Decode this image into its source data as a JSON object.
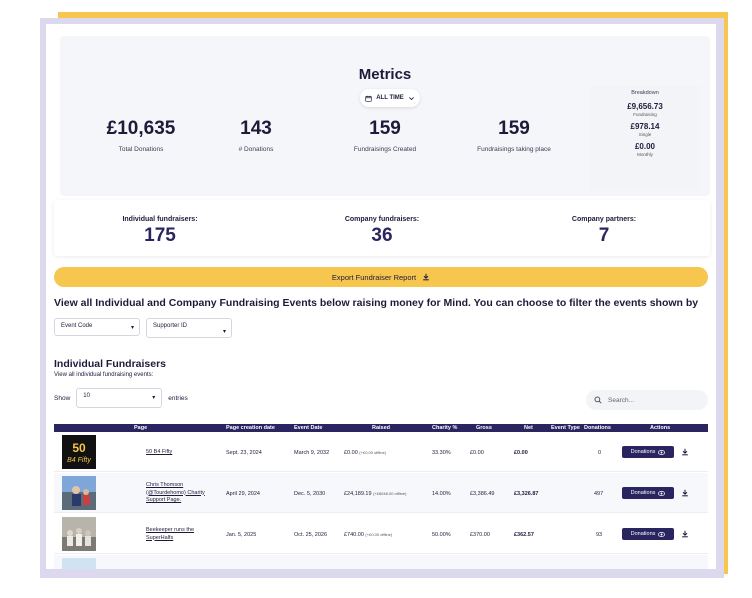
{
  "colors": {
    "accent_yellow": "#f6c64e",
    "navy": "#2a2460",
    "panel": "#f5f6fa"
  },
  "metrics": {
    "title": "Metrics",
    "time_filter": "ALL TIME",
    "stats": [
      {
        "value": "£10,635",
        "label": "Total Donations"
      },
      {
        "value": "143",
        "label": "# Donations"
      },
      {
        "value": "159",
        "label": "Fundraisings Created"
      },
      {
        "value": "159",
        "label": "Fundraisings taking place"
      }
    ],
    "breakdown": {
      "title": "Breakdown",
      "items": [
        {
          "value": "£9,656.73",
          "label": "Fundraising"
        },
        {
          "value": "£978.14",
          "label": "Single"
        },
        {
          "value": "£0.00",
          "label": "Monthly"
        }
      ]
    }
  },
  "partners": {
    "individual": {
      "label": "Individual fundraisers:",
      "value": "175"
    },
    "company": {
      "label": "Company fundraisers:",
      "value": "36"
    },
    "partners": {
      "label": "Company partners:",
      "value": "7"
    }
  },
  "export_label": "Export Fundraiser Report",
  "intro_text": "View all Individual and Company Fundraising Events below raising money for Mind. You can choose to filter the events shown by",
  "filters": {
    "event_code": "Event Code",
    "supporter_id": "Supporter ID"
  },
  "section": {
    "title": "Individual Fundraisers",
    "subtitle": "View all individual fundraising events:",
    "show_label": "Show",
    "entries_value": "10",
    "entries_label": "entries",
    "search_placeholder": "Search..."
  },
  "table": {
    "headers": {
      "page": "Page",
      "created": "Page creation date",
      "event_date": "Event Date",
      "raised": "Raised",
      "charity": "Charity %",
      "gross": "Gross",
      "net": "Net",
      "event_type": "Event Type",
      "donations": "Donations",
      "actions": "Actions"
    },
    "donations_button": "Donations",
    "rows": [
      {
        "page": "50 B4 Fifty",
        "created": "Sept. 23, 2024",
        "event_date": "March 9, 2032",
        "raised": "£0.00",
        "raised_offline": "(+£0.00 offline)",
        "charity": "33.30%",
        "gross": "£0.00",
        "net": "£0.00",
        "donations": "0"
      },
      {
        "page": "Chris Thomson (@Tourdehomo) Charity Support Page.",
        "created": "April 29, 2024",
        "event_date": "Dec. 5, 2030",
        "raised": "£24,189.19",
        "raised_offline": "(+£6048.00 offline)",
        "charity": "14.00%",
        "gross": "£3,386.49",
        "net": "£3,326.87",
        "donations": "497"
      },
      {
        "page": "Beekeeper runs the SuperHalfs",
        "created": "Jan. 5, 2025",
        "event_date": "Oct. 25, 2026",
        "raised": "£740.00",
        "raised_offline": "(+£0.00 offline)",
        "charity": "50.00%",
        "gross": "£370.00",
        "net": "£362.57",
        "donations": "93"
      }
    ]
  }
}
